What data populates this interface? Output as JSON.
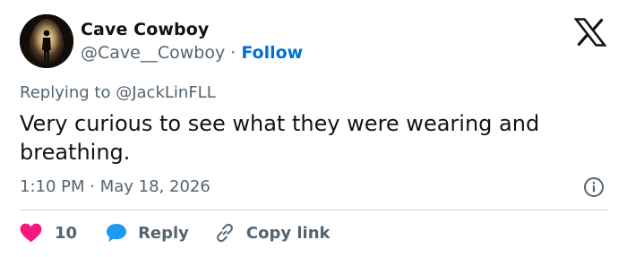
{
  "author": {
    "display_name": "Cave Cowboy",
    "handle": "@Cave__Cowboy",
    "separator": "·",
    "follow_label": "Follow"
  },
  "reply_context": {
    "prefix": "Replying to",
    "mention": "@JackLinFLL"
  },
  "tweet": {
    "text": "Very curious to see what they were wearing and breathing.",
    "time": "1:10 PM",
    "separator": "·",
    "date": "May 18, 2026"
  },
  "actions": {
    "like_count": "10",
    "reply_label": "Reply",
    "copy_link_label": "Copy link"
  },
  "icons": {
    "brand": "x-logo-icon",
    "info": "info-icon",
    "like": "heart-icon",
    "reply": "speech-bubble-icon",
    "copy": "link-icon"
  },
  "colors": {
    "text": "#0f1419",
    "secondary": "#536471",
    "link": "#006fd6",
    "like": "#f91880",
    "reply": "#1d9bf0",
    "divider": "#cfd9de"
  }
}
